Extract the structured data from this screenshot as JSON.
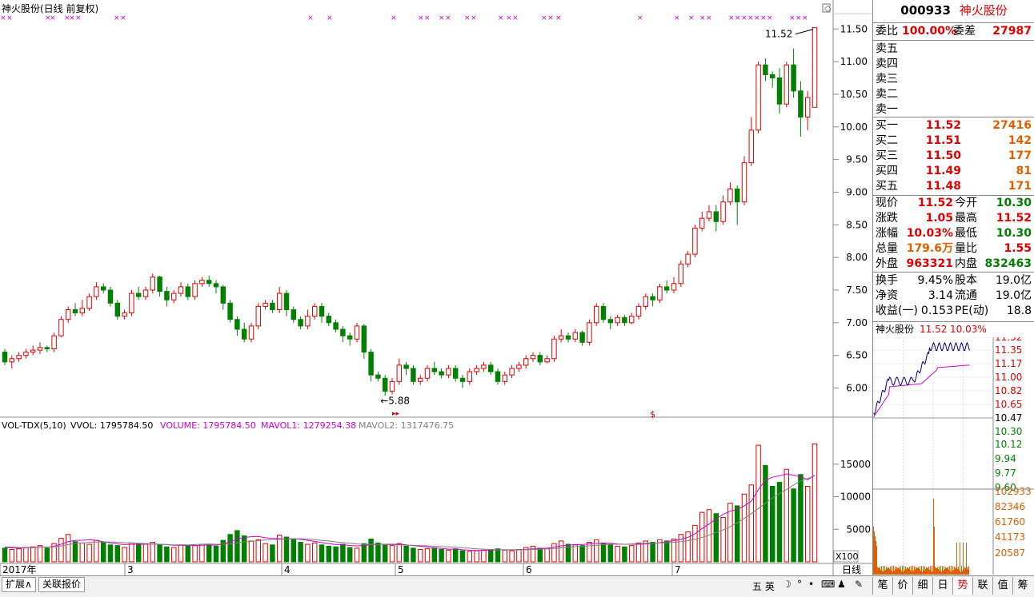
{
  "chart": {
    "title": "神火股份(日线 前复权)",
    "price_labels": [
      "11.50",
      "11.00",
      "10.50",
      "10.00",
      "9.50",
      "9.00",
      "8.50",
      "8.00",
      "7.50",
      "7.00",
      "6.50",
      "6.00"
    ],
    "price_values": [
      11.5,
      11.0,
      10.5,
      10.0,
      9.5,
      9.0,
      8.5,
      8.0,
      7.5,
      7.0,
      6.5,
      6.0
    ],
    "high_marker": "11.52",
    "low_marker": "5.88",
    "vol_line": {
      "name": "VOL-TDX(5,10)",
      "vvol": "VVOL: 1795784.50",
      "volume": "VOLUME: 1795784.50",
      "mavol1": "MAVOL1: 1279254.38",
      "mavol2": "MAVOL2: 1317476.75"
    },
    "vol_labels": [
      "15000",
      "10000",
      "5000"
    ],
    "vol_values": [
      15000,
      10000,
      5000
    ],
    "x100": "X100",
    "months": [
      "2017年",
      "3",
      "4",
      "5",
      "6",
      "7"
    ],
    "corner_label": "日线",
    "chart_data": {
      "type": "candlestick",
      "ylim": [
        5.7,
        11.65
      ],
      "vol_ylim": [
        0,
        20000
      ],
      "candles": [
        [
          6.55,
          6.4,
          6.6,
          6.35
        ],
        [
          6.4,
          6.45,
          6.5,
          6.3
        ],
        [
          6.45,
          6.5,
          6.55,
          6.4
        ],
        [
          6.5,
          6.55,
          6.6,
          6.45
        ],
        [
          6.55,
          6.58,
          6.65,
          6.5
        ],
        [
          6.58,
          6.62,
          6.7,
          6.52
        ],
        [
          6.62,
          6.6,
          6.65,
          6.55
        ],
        [
          6.6,
          6.8,
          6.85,
          6.55
        ],
        [
          6.8,
          7.05,
          7.1,
          6.78
        ],
        [
          7.05,
          7.2,
          7.25,
          7.0
        ],
        [
          7.2,
          7.15,
          7.3,
          7.1
        ],
        [
          7.15,
          7.22,
          7.35,
          7.1
        ],
        [
          7.22,
          7.4,
          7.45,
          7.18
        ],
        [
          7.4,
          7.55,
          7.62,
          7.35
        ],
        [
          7.55,
          7.5,
          7.6,
          7.45
        ],
        [
          7.5,
          7.3,
          7.55,
          7.25
        ],
        [
          7.3,
          7.1,
          7.35,
          7.05
        ],
        [
          7.1,
          7.15,
          7.2,
          7.05
        ],
        [
          7.15,
          7.45,
          7.5,
          7.1
        ],
        [
          7.45,
          7.4,
          7.55,
          7.35
        ],
        [
          7.4,
          7.5,
          7.55,
          7.35
        ],
        [
          7.5,
          7.7,
          7.75,
          7.45
        ],
        [
          7.7,
          7.48,
          7.72,
          7.4
        ],
        [
          7.48,
          7.35,
          7.55,
          7.25
        ],
        [
          7.35,
          7.45,
          7.5,
          7.3
        ],
        [
          7.45,
          7.55,
          7.62,
          7.4
        ],
        [
          7.55,
          7.4,
          7.6,
          7.35
        ],
        [
          7.4,
          7.6,
          7.65,
          7.35
        ],
        [
          7.6,
          7.65,
          7.7,
          7.55
        ],
        [
          7.65,
          7.6,
          7.72,
          7.55
        ],
        [
          7.6,
          7.55,
          7.65,
          7.45
        ],
        [
          7.55,
          7.3,
          7.58,
          7.2
        ],
        [
          7.3,
          7.05,
          7.35,
          7.0
        ],
        [
          7.05,
          6.9,
          7.1,
          6.8
        ],
        [
          6.9,
          6.75,
          7.0,
          6.7
        ],
        [
          6.75,
          6.95,
          7.0,
          6.7
        ],
        [
          6.95,
          7.25,
          7.3,
          6.9
        ],
        [
          7.25,
          7.3,
          7.35,
          7.2
        ],
        [
          7.3,
          7.2,
          7.35,
          7.15
        ],
        [
          7.2,
          7.45,
          7.55,
          7.15
        ],
        [
          7.45,
          7.2,
          7.5,
          7.1
        ],
        [
          7.2,
          7.05,
          7.25,
          7.0
        ],
        [
          7.05,
          6.95,
          7.1,
          6.9
        ],
        [
          6.95,
          7.1,
          7.2,
          6.9
        ],
        [
          7.1,
          7.25,
          7.3,
          7.05
        ],
        [
          7.25,
          7.1,
          7.3,
          7.0
        ],
        [
          7.1,
          7.0,
          7.15,
          6.95
        ],
        [
          7.0,
          6.9,
          7.05,
          6.85
        ],
        [
          6.9,
          6.8,
          6.95,
          6.7
        ],
        [
          6.8,
          6.75,
          6.85,
          6.65
        ],
        [
          6.75,
          6.95,
          7.0,
          6.7
        ],
        [
          6.95,
          6.55,
          6.98,
          6.45
        ],
        [
          6.55,
          6.2,
          6.6,
          6.1
        ],
        [
          6.2,
          6.15,
          6.25,
          6.1
        ],
        [
          6.15,
          5.95,
          6.2,
          5.88
        ],
        [
          5.95,
          6.1,
          6.15,
          5.9
        ],
        [
          6.1,
          6.35,
          6.45,
          6.05
        ],
        [
          6.35,
          6.3,
          6.4,
          6.2
        ],
        [
          6.3,
          6.1,
          6.35,
          6.05
        ],
        [
          6.1,
          6.15,
          6.2,
          6.05
        ],
        [
          6.15,
          6.3,
          6.35,
          6.1
        ],
        [
          6.3,
          6.25,
          6.4,
          6.2
        ],
        [
          6.25,
          6.2,
          6.3,
          6.15
        ],
        [
          6.2,
          6.3,
          6.35,
          6.15
        ],
        [
          6.3,
          6.15,
          6.35,
          6.1
        ],
        [
          6.15,
          6.1,
          6.2,
          6.0
        ],
        [
          6.1,
          6.25,
          6.3,
          6.05
        ],
        [
          6.25,
          6.3,
          6.35,
          6.2
        ],
        [
          6.3,
          6.35,
          6.4,
          6.25
        ],
        [
          6.35,
          6.25,
          6.4,
          6.2
        ],
        [
          6.25,
          6.1,
          6.3,
          6.05
        ],
        [
          6.1,
          6.2,
          6.25,
          6.05
        ],
        [
          6.2,
          6.3,
          6.35,
          6.15
        ],
        [
          6.3,
          6.35,
          6.4,
          6.25
        ],
        [
          6.35,
          6.45,
          6.5,
          6.3
        ],
        [
          6.45,
          6.5,
          6.55,
          6.4
        ],
        [
          6.5,
          6.4,
          6.55,
          6.35
        ],
        [
          6.4,
          6.45,
          6.5,
          6.38
        ],
        [
          6.45,
          6.75,
          6.8,
          6.4
        ],
        [
          6.75,
          6.8,
          6.9,
          6.7
        ],
        [
          6.8,
          6.75,
          6.85,
          6.7
        ],
        [
          6.75,
          6.85,
          6.9,
          6.7
        ],
        [
          6.85,
          6.7,
          6.88,
          6.65
        ],
        [
          6.7,
          7.0,
          7.05,
          6.65
        ],
        [
          7.0,
          7.25,
          7.3,
          6.95
        ],
        [
          7.25,
          7.05,
          7.3,
          7.0
        ],
        [
          7.05,
          7.0,
          7.1,
          6.9
        ],
        [
          7.0,
          7.08,
          7.12,
          6.95
        ],
        [
          7.08,
          7.0,
          7.12,
          6.95
        ],
        [
          7.0,
          7.1,
          7.15,
          6.98
        ],
        [
          7.1,
          7.25,
          7.3,
          7.05
        ],
        [
          7.25,
          7.4,
          7.45,
          7.2
        ],
        [
          7.4,
          7.35,
          7.45,
          7.25
        ],
        [
          7.35,
          7.55,
          7.6,
          7.3
        ],
        [
          7.55,
          7.5,
          7.65,
          7.45
        ],
        [
          7.5,
          7.6,
          7.7,
          7.45
        ],
        [
          7.6,
          7.9,
          7.95,
          7.55
        ],
        [
          7.9,
          8.05,
          8.1,
          7.85
        ],
        [
          8.05,
          8.45,
          8.5,
          8.0
        ],
        [
          8.45,
          8.6,
          8.7,
          8.4
        ],
        [
          8.6,
          8.7,
          8.8,
          8.55
        ],
        [
          8.7,
          8.55,
          8.8,
          8.4
        ],
        [
          8.55,
          8.85,
          8.95,
          8.5
        ],
        [
          8.85,
          9.05,
          9.15,
          8.8
        ],
        [
          9.05,
          8.85,
          9.1,
          8.5
        ],
        [
          8.85,
          9.45,
          9.55,
          8.8
        ],
        [
          9.45,
          9.95,
          10.15,
          9.4
        ],
        [
          9.95,
          10.95,
          11.0,
          9.9
        ],
        [
          10.95,
          10.8,
          11.05,
          10.7
        ],
        [
          10.8,
          10.75,
          10.85,
          10.6
        ],
        [
          10.75,
          10.35,
          10.9,
          10.2
        ],
        [
          10.35,
          10.95,
          11.0,
          10.3
        ],
        [
          10.95,
          10.55,
          11.2,
          10.45
        ],
        [
          10.55,
          10.15,
          10.7,
          9.85
        ],
        [
          10.15,
          10.45,
          10.55,
          9.95
        ],
        [
          10.3,
          11.52,
          11.52,
          10.3
        ]
      ],
      "volumes": [
        2100,
        1900,
        2000,
        2200,
        2300,
        2500,
        2100,
        2800,
        3600,
        4200,
        3100,
        2900,
        2700,
        3300,
        3000,
        2600,
        2500,
        2200,
        2900,
        2800,
        2700,
        3000,
        2600,
        2300,
        2200,
        2600,
        2400,
        2500,
        2700,
        2600,
        2400,
        3300,
        4200,
        4800,
        4000,
        3200,
        3400,
        2800,
        2600,
        4100,
        3800,
        3500,
        3000,
        2700,
        2900,
        2600,
        2400,
        2300,
        2700,
        2200,
        2100,
        2800,
        3500,
        2900,
        2600,
        2500,
        2800,
        2400,
        2100,
        1900,
        2000,
        2100,
        1900,
        1800,
        2000,
        1700,
        1600,
        1700,
        1800,
        1900,
        2000,
        1800,
        1700,
        1900,
        2200,
        2400,
        2100,
        2000,
        2800,
        3200,
        2700,
        2600,
        2500,
        3000,
        3400,
        2900,
        2600,
        2400,
        2300,
        2500,
        2900,
        3200,
        3000,
        3400,
        3200,
        3500,
        4200,
        4600,
        5600,
        7600,
        8000,
        7400,
        6800,
        9000,
        8600,
        10400,
        11800,
        17900,
        14800,
        11600,
        12200,
        14200,
        11200,
        13400,
        11600,
        18100
      ],
      "ma5": [
        2200,
        2150,
        2100,
        2150,
        2200,
        2300,
        2250,
        2400,
        2700,
        3100,
        3300,
        3300,
        3400,
        3300,
        3100,
        2900,
        2750,
        2650,
        2700,
        2700,
        2700,
        2750,
        2700,
        2650,
        2550,
        2550,
        2500,
        2500,
        2550,
        2600,
        2550,
        2750,
        3050,
        3500,
        3750,
        3850,
        3900,
        3700,
        3600,
        3550,
        3500,
        3550,
        3450,
        3300,
        3150,
        2950,
        2800,
        2650,
        2650,
        2500,
        2450,
        2500,
        2600,
        2700,
        2700,
        2700,
        2700,
        2600,
        2500,
        2400,
        2300,
        2150,
        2050,
        1950,
        1950,
        1850,
        1800,
        1750,
        1750,
        1800,
        1850,
        1850,
        1850,
        1850,
        1900,
        2000,
        2050,
        2100,
        2250,
        2450,
        2550,
        2650,
        2650,
        2750,
        2850,
        2850,
        2850,
        2750,
        2700,
        2700,
        2700,
        2750,
        2800,
        2950,
        3100,
        3250,
        3450,
        3750,
        4300,
        5100,
        5800,
        6600,
        7300,
        7800,
        8000,
        8600,
        9300,
        11100,
        12500,
        13000,
        13200,
        13500,
        13300,
        13100,
        12600,
        13300
      ],
      "ma10": [
        2300,
        2250,
        2200,
        2200,
        2200,
        2250,
        2250,
        2300,
        2450,
        2650,
        2800,
        2900,
        3000,
        3050,
        3050,
        3050,
        3000,
        2950,
        2900,
        2850,
        2800,
        2750,
        2700,
        2650,
        2600,
        2600,
        2600,
        2650,
        2700,
        2750,
        2700,
        2700,
        2750,
        2900,
        3050,
        3150,
        3250,
        3350,
        3400,
        3450,
        3500,
        3550,
        3550,
        3500,
        3400,
        3300,
        3200,
        3050,
        2950,
        2850,
        2750,
        2700,
        2700,
        2700,
        2650,
        2600,
        2600,
        2550,
        2550,
        2500,
        2450,
        2400,
        2350,
        2300,
        2250,
        2150,
        2100,
        2000,
        1950,
        1900,
        1850,
        1850,
        1850,
        1850,
        1850,
        1900,
        1950,
        2000,
        2050,
        2150,
        2250,
        2350,
        2400,
        2450,
        2550,
        2650,
        2700,
        2700,
        2700,
        2750,
        2800,
        2850,
        2850,
        2900,
        2950,
        3000,
        3100,
        3250,
        3450,
        3750,
        4100,
        4500,
        4900,
        5400,
        6000,
        6700,
        7400,
        8200,
        9000,
        9800,
        10500,
        11100,
        11800,
        12400,
        12800,
        13200
      ]
    }
  },
  "panel": {
    "code": "000933",
    "name": "神火股份",
    "weibi_label": "委比",
    "weibi_value": "100.00%",
    "weicha_label": "委差",
    "weicha_value": "27987",
    "sells": [
      {
        "label": "卖五",
        "price": "",
        "vol": ""
      },
      {
        "label": "卖四",
        "price": "",
        "vol": ""
      },
      {
        "label": "卖三",
        "price": "",
        "vol": ""
      },
      {
        "label": "卖二",
        "price": "",
        "vol": ""
      },
      {
        "label": "卖一",
        "price": "",
        "vol": ""
      }
    ],
    "buys": [
      {
        "label": "买一",
        "price": "11.52",
        "vol": "27416"
      },
      {
        "label": "买二",
        "price": "11.51",
        "vol": "142"
      },
      {
        "label": "买三",
        "price": "11.50",
        "vol": "177"
      },
      {
        "label": "买四",
        "price": "11.49",
        "vol": "81"
      },
      {
        "label": "买五",
        "price": "11.48",
        "vol": "171"
      }
    ],
    "stats1": [
      {
        "l1": "现价",
        "v1": "11.52",
        "c1": "red",
        "l2": "今开",
        "v2": "10.30",
        "c2": "grn"
      },
      {
        "l1": "涨跌",
        "v1": "1.05",
        "c1": "red",
        "l2": "最高",
        "v2": "11.52",
        "c2": "red"
      },
      {
        "l1": "涨幅",
        "v1": "10.03%",
        "c1": "red",
        "l2": "最低",
        "v2": "10.30",
        "c2": "grn"
      },
      {
        "l1": "总量",
        "v1": "179.6万",
        "c1": "org",
        "l2": "量比",
        "v2": "1.55",
        "c2": "red"
      },
      {
        "l1": "外盘",
        "v1": "963321",
        "c1": "red",
        "l2": "内盘",
        "v2": "832463",
        "c2": "grn"
      }
    ],
    "stats2": [
      {
        "l1": "换手",
        "v1": "9.45%",
        "l2": "股本",
        "v2": "19.0亿"
      },
      {
        "l1": "净资",
        "v1": "3.14",
        "l2": "流通",
        "v2": "19.0亿"
      },
      {
        "l1": "收益(一)",
        "v1": "0.153",
        "l2": "PE(动)",
        "v2": "18.8"
      }
    ],
    "mini_title": "神火股份",
    "mini_price": "11.52",
    "mini_pct": "10.03%",
    "mini_labels_red": [
      "11.52",
      "11.35",
      "11.17",
      "11.00",
      "10.82",
      "10.65"
    ],
    "mini_mid": "10.47",
    "mini_labels_green": [
      "10.30",
      "10.12",
      "9.94",
      "9.77",
      "9.60"
    ],
    "mini_vol_labels": [
      "102933",
      "82346",
      "61760",
      "41173",
      "20587"
    ]
  },
  "bottom": {
    "tab1": "扩展∧",
    "tab2": "关联报价",
    "right_tabs": [
      "笔",
      "价",
      "细",
      "日",
      "势",
      "联",
      "值",
      "筹"
    ],
    "ime": "五 英"
  }
}
